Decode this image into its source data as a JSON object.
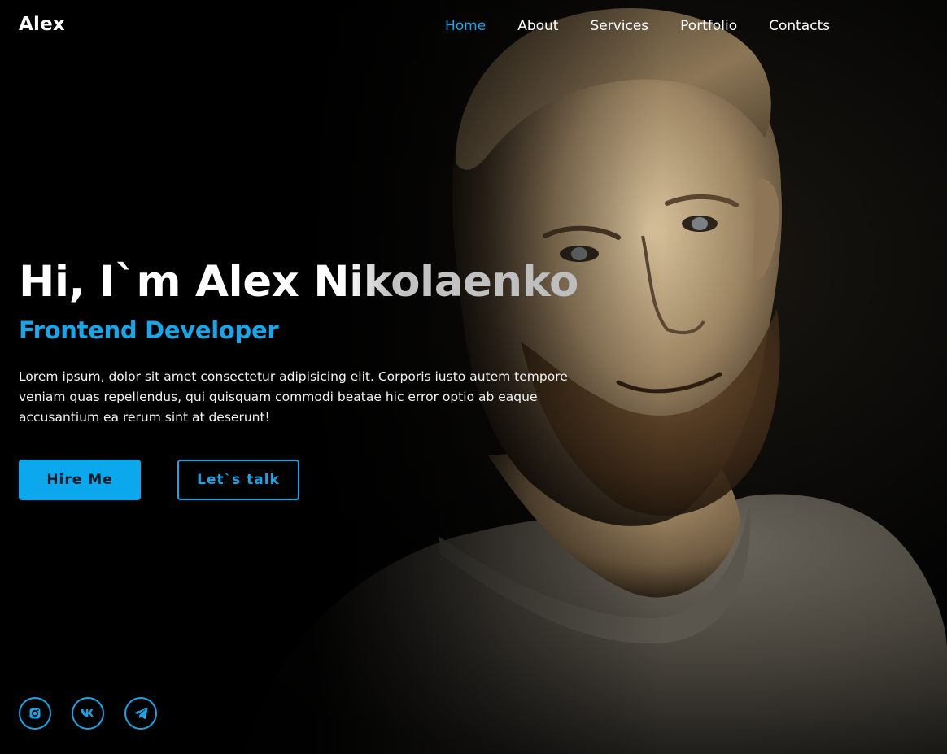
{
  "brand": {
    "logo": "Alex"
  },
  "nav": {
    "items": [
      {
        "label": "Home",
        "active": true
      },
      {
        "label": "About",
        "active": false
      },
      {
        "label": "Services",
        "active": false
      },
      {
        "label": "Portfolio",
        "active": false
      },
      {
        "label": "Contacts",
        "active": false
      }
    ]
  },
  "hero": {
    "title": "Hi, I`m Alex Nikolaenko",
    "subtitle": "Frontend Developer",
    "description": "Lorem ipsum, dolor sit amet consectetur adipisicing elit. Corporis iusto autem tempore veniam quas repellendus, qui quisquam commodi beatae hic error optio ab eaque accusantium ea rerum sint at deserunt!",
    "primary_button": "Hire Me",
    "secondary_button": "Let`s talk"
  },
  "socials": [
    {
      "icon": "instagram-icon"
    },
    {
      "icon": "vk-icon"
    },
    {
      "icon": "telegram-icon"
    }
  ],
  "colors": {
    "accent": "#16a7ea",
    "background": "#030303",
    "text": "#ffffff"
  }
}
